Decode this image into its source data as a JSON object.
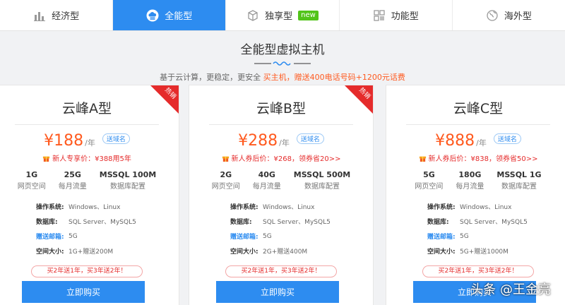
{
  "tabs": [
    {
      "label": "经济型",
      "icon": "bar-chart-icon",
      "active": false
    },
    {
      "label": "全能型",
      "icon": "cloud-server-icon",
      "active": true
    },
    {
      "label": "独享型",
      "icon": "cube-icon",
      "active": false,
      "badge": "new"
    },
    {
      "label": "功能型",
      "icon": "grid-icon",
      "active": false
    },
    {
      "label": "海外型",
      "icon": "globe-icon",
      "active": false
    }
  ],
  "heading": {
    "title": "全能型虚拟主机",
    "sub_prefix": "基于云计算，更稳定，更安全",
    "sub_highlight": "买主机，赠送400电话号码+1200元话费"
  },
  "cards": [
    {
      "name": "云峰A型",
      "hot": "热销",
      "price": "¥188",
      "per": "/年",
      "domain_tag": "送域名",
      "promo": "新人专享价：¥388用5年",
      "specs": [
        {
          "value": "1G",
          "label": "网页空间"
        },
        {
          "value": "25G",
          "label": "每月流量"
        },
        {
          "value": "MSSQL 100M",
          "label": "数据库配置"
        }
      ],
      "details": [
        {
          "key": "操作系统:",
          "value": "Windows、Linux"
        },
        {
          "key": "数据库:",
          "value": "SQL Server、MySQL5"
        },
        {
          "key": "赠送邮箱:",
          "value": "5G"
        },
        {
          "key": "空间大小:",
          "value": "1G+赠送200M"
        }
      ],
      "offer": "买2年送1年，买3年送2年！",
      "buy": "立即购买"
    },
    {
      "name": "云峰B型",
      "hot": "热销",
      "price": "¥288",
      "per": "/年",
      "domain_tag": "送域名",
      "promo": "新人券后价：¥268，领券省20>>",
      "specs": [
        {
          "value": "2G",
          "label": "网页空间"
        },
        {
          "value": "40G",
          "label": "每月流量"
        },
        {
          "value": "MSSQL 500M",
          "label": "数据库配置"
        }
      ],
      "details": [
        {
          "key": "操作系统:",
          "value": "Windows、Linux"
        },
        {
          "key": "数据库:",
          "value": "SQL Server、MySQL5"
        },
        {
          "key": "赠送邮箱:",
          "value": "5G"
        },
        {
          "key": "空间大小:",
          "value": "2G+赠送400M"
        }
      ],
      "offer": "买2年送1年，买3年送2年！",
      "buy": "立即购买"
    },
    {
      "name": "云峰C型",
      "hot": "",
      "price": "¥888",
      "per": "/年",
      "domain_tag": "送域名",
      "promo": "新人券后价：¥838，领券省50>>",
      "specs": [
        {
          "value": "5G",
          "label": "网页空间"
        },
        {
          "value": "180G",
          "label": "每月流量"
        },
        {
          "value": "MSSQL 1G",
          "label": "数据库配置"
        }
      ],
      "details": [
        {
          "key": "操作系统:",
          "value": "Windows、Linux"
        },
        {
          "key": "数据库:",
          "value": "SQL Server、MySQL5"
        },
        {
          "key": "赠送邮箱:",
          "value": "5G"
        },
        {
          "key": "空间大小:",
          "value": "5G+赠送1000M"
        }
      ],
      "offer": "买2年送1年，买3年送2年！",
      "buy": "立即购买"
    }
  ],
  "watermark": "头条 @王金亮",
  "colors": {
    "accent": "#2d8cf0",
    "price": "#ff5a1f",
    "hot": "#e52b2b",
    "new_badge": "#52c41a"
  }
}
